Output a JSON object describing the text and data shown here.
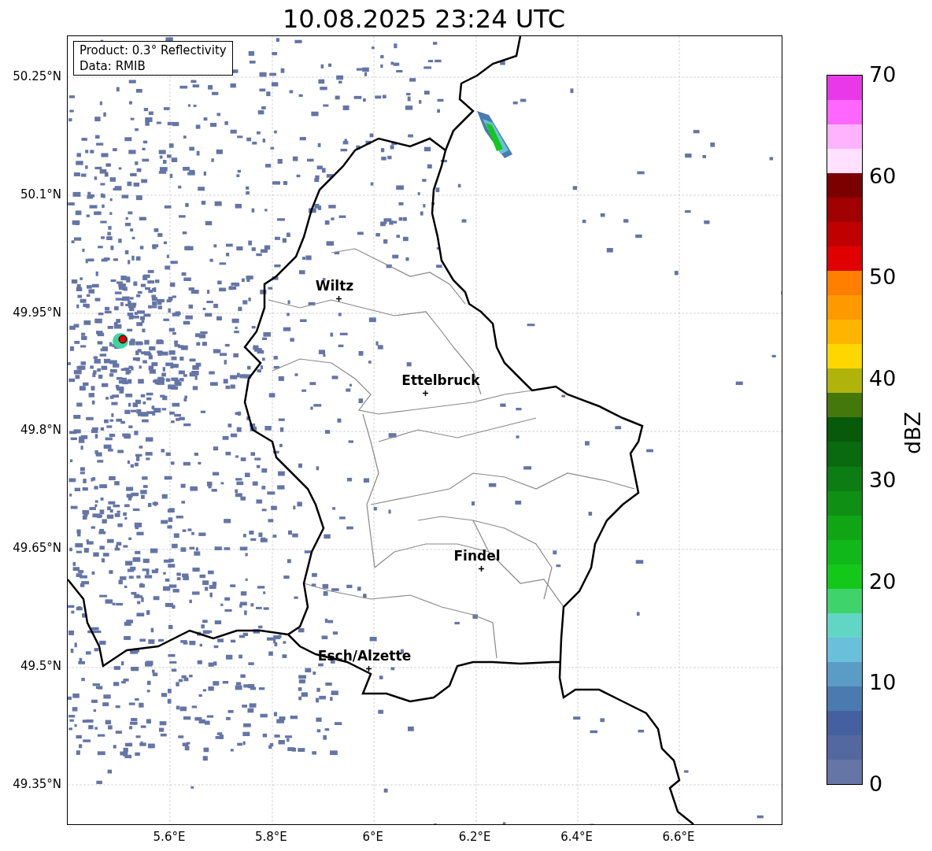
{
  "title": "10.08.2025 23:24 UTC",
  "info_box": {
    "product": "Product: 0.3° Reflectivity",
    "data": "Data: RMIB"
  },
  "lat_labels": [
    "50.25°N",
    "50.1°N",
    "49.95°N",
    "49.8°N",
    "49.65°N",
    "49.5°N",
    "49.35°N"
  ],
  "lon_labels": [
    "5.6°E",
    "5.8°E",
    "6°E",
    "6.2°E",
    "6.4°E",
    "6.6°E"
  ],
  "cities": [
    {
      "name": "Wiltz"
    },
    {
      "name": "Ettelbruck"
    },
    {
      "name": "Findel"
    },
    {
      "name": "Esch/Alzette"
    }
  ],
  "colorbar": {
    "label": "dBZ",
    "ticks": [
      "70",
      "60",
      "50",
      "40",
      "30",
      "20",
      "10",
      "0"
    ],
    "bands": [
      {
        "color": "#e838e8"
      },
      {
        "color": "#ff66ff"
      },
      {
        "color": "#ffb3ff"
      },
      {
        "color": "#ffe0ff"
      },
      {
        "color": "#7b0000"
      },
      {
        "color": "#a00000"
      },
      {
        "color": "#c00000"
      },
      {
        "color": "#e00000"
      },
      {
        "color": "#ff7f00"
      },
      {
        "color": "#ff9900"
      },
      {
        "color": "#ffb400"
      },
      {
        "color": "#ffd700"
      },
      {
        "color": "#b0b40a"
      },
      {
        "color": "#44780a"
      },
      {
        "color": "#065a0a"
      },
      {
        "color": "#0a6a10"
      },
      {
        "color": "#0c7d12"
      },
      {
        "color": "#0f9015"
      },
      {
        "color": "#10a515"
      },
      {
        "color": "#11b81a"
      },
      {
        "color": "#14c81a"
      },
      {
        "color": "#3fd46b"
      },
      {
        "color": "#62d6c4"
      },
      {
        "color": "#68c0db"
      },
      {
        "color": "#5a9cc5"
      },
      {
        "color": "#4a7ab0"
      },
      {
        "color": "#4560a0"
      },
      {
        "color": "#5468a0"
      },
      {
        "color": "#6475a6"
      }
    ]
  }
}
